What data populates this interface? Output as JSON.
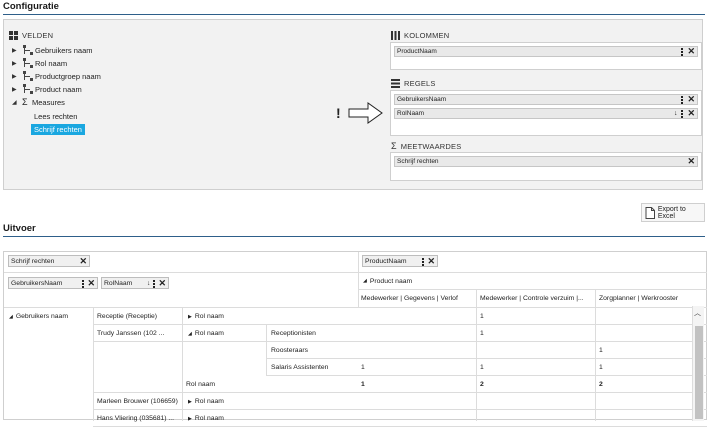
{
  "config": {
    "title": "Configuratie",
    "fields_header": "VELDEN",
    "tree": [
      {
        "label": "Gebruikers naam",
        "expanded": false
      },
      {
        "label": "Rol naam",
        "expanded": false
      },
      {
        "label": "Productgroep naam",
        "expanded": false
      },
      {
        "label": "Product naam",
        "expanded": false
      },
      {
        "label": "Measures",
        "expanded": true
      }
    ],
    "measures": [
      {
        "label": "Lees rechten",
        "selected": false
      },
      {
        "label": "Schrijf rechten",
        "selected": true
      }
    ],
    "annotation": "!",
    "columns": {
      "header": "KOLOMMEN",
      "items": [
        "ProductNaam"
      ]
    },
    "rows": {
      "header": "REGELS",
      "items": [
        "GebruikersNaam",
        "RolNaam"
      ]
    },
    "measures_zone": {
      "header": "MEETWAARDES",
      "items": [
        "Schrijf rechten"
      ]
    },
    "sort_arrow": "↓",
    "close_glyph": "✕"
  },
  "export": {
    "label": "Export to Excel"
  },
  "output": {
    "title": "Uitvoer",
    "measure_pill": "Schrijf rechten",
    "column_pill": "ProductNaam",
    "row_pills": [
      "GebruikersNaam",
      "RolNaam"
    ],
    "column_group": "Product naam",
    "columns": [
      "Medewerker | Gegevens | Verlof",
      "Medewerker | Controle verzuim |...",
      "Zorgplanner | Werkrooster"
    ],
    "rows": [
      {
        "level1": "Gebruikers naam",
        "level2": "Receptie (Receptie)",
        "level3": "Rol naam",
        "level4": "",
        "values": [
          "",
          "1",
          ""
        ]
      },
      {
        "level1": "",
        "level2": "Trudy Janssen (102 ...",
        "level3": "Rol naam",
        "level4": "Receptionisten",
        "values": [
          "",
          "1",
          ""
        ]
      },
      {
        "level1": "",
        "level2": "",
        "level3": "",
        "level4": "Roosteraars",
        "values": [
          "",
          "",
          "1"
        ]
      },
      {
        "level1": "",
        "level2": "",
        "level3": "",
        "level4": "Salaris Assistenten",
        "values": [
          "1",
          "1",
          "1"
        ]
      },
      {
        "level1": "",
        "level2": "",
        "level3": "Rol naam",
        "level4": "",
        "values": [
          "1",
          "2",
          "2"
        ],
        "total": true
      },
      {
        "level1": "",
        "level2": "Marleen Brouwer (106659)",
        "level3": "Rol naam",
        "level4": "",
        "values": [
          "",
          "",
          ""
        ]
      },
      {
        "level1": "",
        "level2": "Hans Vliering (035681) ...",
        "level3": "Rol naam",
        "level4": "",
        "values": [
          "",
          "",
          ""
        ]
      }
    ]
  }
}
